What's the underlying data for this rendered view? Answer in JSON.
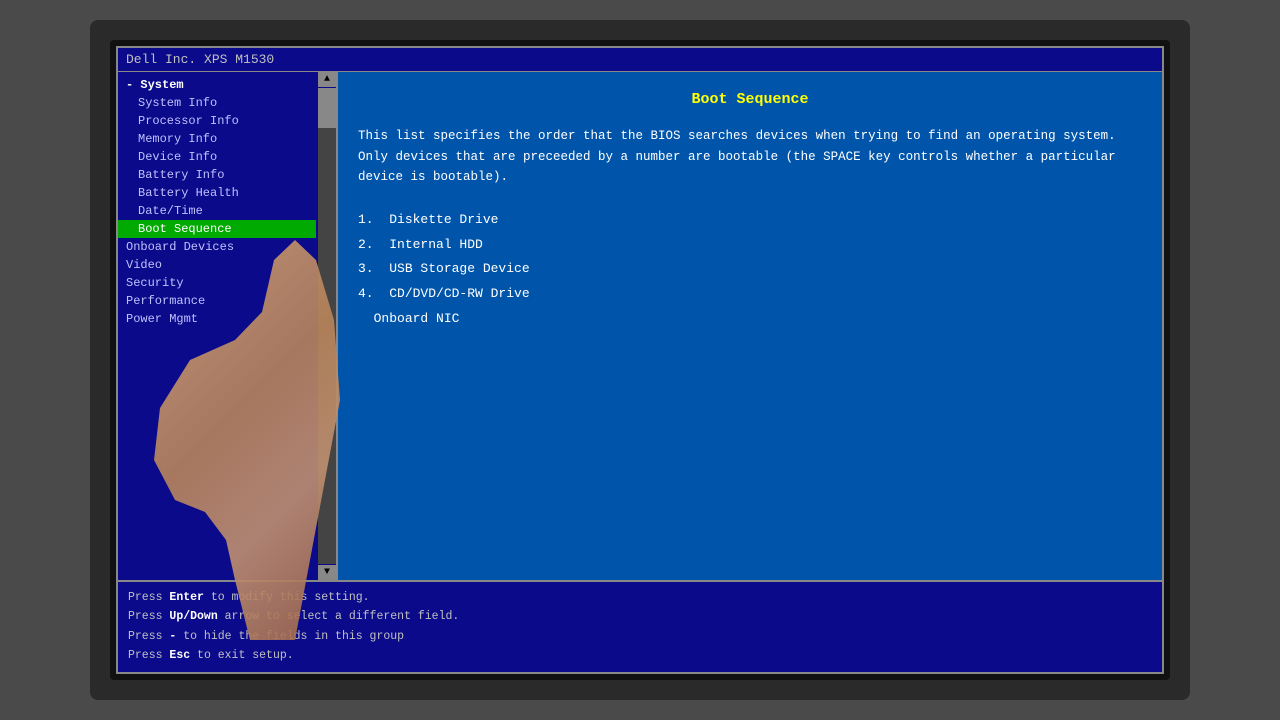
{
  "title_bar": {
    "text": "Dell Inc.  XPS M1530"
  },
  "sidebar": {
    "scroll_up": "▲",
    "scroll_down": "▼",
    "items": [
      {
        "label": "- System",
        "type": "header",
        "indent": false
      },
      {
        "label": "System Info",
        "type": "normal",
        "indent": true
      },
      {
        "label": "Processor Info",
        "type": "normal",
        "indent": true
      },
      {
        "label": "Memory Info",
        "type": "normal",
        "indent": true
      },
      {
        "label": "Device Info",
        "type": "normal",
        "indent": true
      },
      {
        "label": "Battery Info",
        "type": "normal",
        "indent": true
      },
      {
        "label": "Battery Health",
        "type": "normal",
        "indent": true
      },
      {
        "label": "Date/Time",
        "type": "normal",
        "indent": true
      },
      {
        "label": "Boot Sequence",
        "type": "active",
        "indent": true
      },
      {
        "label": "Onboard Devices",
        "type": "normal",
        "indent": false
      },
      {
        "label": "Video",
        "type": "normal",
        "indent": false
      },
      {
        "label": "Security",
        "type": "normal",
        "indent": false
      },
      {
        "label": "Performance",
        "type": "normal",
        "indent": false
      },
      {
        "label": "Power Mgmt",
        "type": "normal",
        "indent": false
      }
    ]
  },
  "content": {
    "title": "Boot Sequence",
    "description": "This list specifies the order that the BIOS searches devices when trying to find an operating system. Only devices that are preceeded by a number are bootable (the SPACE key controls whether a particular device is bootable).",
    "boot_devices": [
      {
        "num": "1.",
        "label": "Diskette Drive"
      },
      {
        "num": "2.",
        "label": "Internal HDD"
      },
      {
        "num": "3.",
        "label": "USB Storage Device"
      },
      {
        "num": "4.",
        "label": "CD/DVD/CD-RW Drive"
      },
      {
        "num": "",
        "label": "Onboard NIC"
      }
    ]
  },
  "status_bar": {
    "lines": [
      {
        "key": "Enter",
        "desc": " to modify this setting."
      },
      {
        "key": "Up/Down",
        "desc": " arrow to select a different field."
      },
      {
        "key": "-",
        "desc": " to hide the fields in this group"
      },
      {
        "key": "Esc",
        "desc": " to exit setup."
      }
    ]
  }
}
